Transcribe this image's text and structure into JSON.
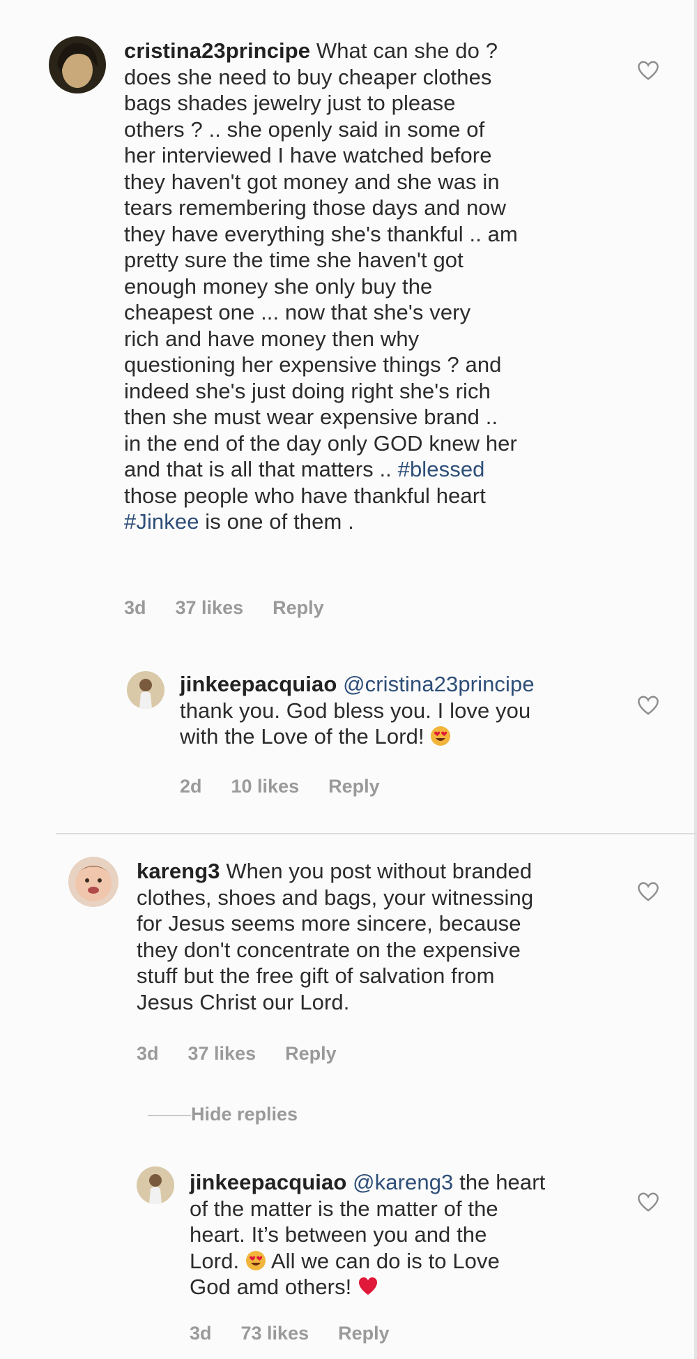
{
  "comments": [
    {
      "username": "cristina23principe",
      "text_a": " What can she do ?\ndoes she need to buy cheaper  clothes\nbags  shades jewelry just  to please\nothers ? .. she openly  said in some of\nher interviewed I have watched before\nthey haven't  got  money and she was in\ntears remembering those days and now\nthey have everything she's thankful .. am\npretty  sure the time she haven't got\nenough  money  she  only buy the\ncheapest  one ... now that she's  very\nrich  and have  money  then why\nquestioning her expensive things ? and\nindeed she's just  doing  right  she's  rich\nthen she must wear  expensive brand ..\nin the end of the day  only GOD knew her\nand that  is all that matters .. ",
      "hashtag_1": "#blessed",
      "text_b": "\nthose  people who have thankful heart\n",
      "hashtag_2": "#Jinkee",
      "text_c": " is one of them .",
      "time": "3d",
      "likes": "37 likes",
      "reply": "Reply"
    },
    {
      "username": "jinkeepacquiao",
      "mention": "@cristina23principe",
      "text": "\nthank you. God bless you. I love you\nwith the Love of the Lord! ",
      "emoji": "heart-eyes-emoji",
      "time": "2d",
      "likes": "10 likes",
      "reply": "Reply"
    },
    {
      "username": "kareng3",
      "text": " When you post without branded\nclothes, shoes and bags, your witnessing\nfor Jesus seems more sincere, because\nthey don't concentrate on  the expensive\nstuff but the free gift of salvation from\nJesus Christ our Lord.",
      "time": "3d",
      "likes": "37 likes",
      "reply": "Reply",
      "hide_replies": "Hide replies"
    },
    {
      "username": "jinkeepacquiao",
      "mention": "@kareng3",
      "text_a": " the heart\nof the matter is the matter of the\nheart. It’s between you and the\nLord. ",
      "text_b": "  All we can do is to Love\nGod amd others! ",
      "emoji_1": "heart-eyes-emoji",
      "emoji_2": "red-heart-emoji",
      "time": "3d",
      "likes": "73 likes",
      "reply": "Reply"
    }
  ],
  "icons": {
    "like": "heart-outline-icon"
  },
  "colors": {
    "hashtag": "#2e4e78",
    "meta": "#9a9a9a",
    "heart_emoji": "#e0183a"
  }
}
